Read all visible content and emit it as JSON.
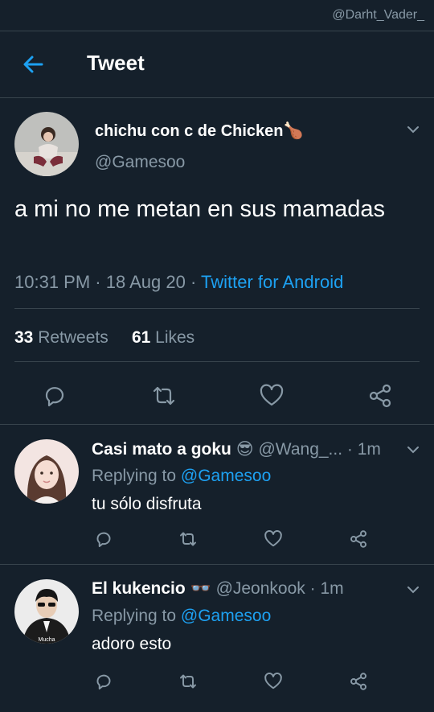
{
  "watermark": "@Darht_Vader_",
  "header": {
    "title": "Tweet"
  },
  "main_tweet": {
    "name": "chichu con c de Chicken",
    "name_emoji": "🍗",
    "handle": "@Gamesoo",
    "text": "a mi no me metan en sus mamadas",
    "time": "10:31 PM",
    "date": "18 Aug 20",
    "source": "Twitter for Android",
    "retweets_count": "33",
    "retweets_label": "Retweets",
    "likes_count": "61",
    "likes_label": "Likes"
  },
  "replies": [
    {
      "name": "Casi mato a goku",
      "emoji": "😎",
      "handle": "@Wang_...",
      "time": "1m",
      "replying_prefix": "Replying to",
      "replying_to": "@Gamesoo",
      "text": "tu sólo disfruta"
    },
    {
      "name": "El kukencio",
      "emoji": "👓",
      "handle": "@Jeonkook",
      "time": "1m",
      "replying_prefix": "Replying to",
      "replying_to": "@Gamesoo",
      "text": "adoro esto",
      "avatar_caption": "Mucha"
    }
  ],
  "colors": {
    "background": "#15202b",
    "accent": "#1da1f2",
    "muted": "#8899a6",
    "divider": "#38444d"
  }
}
